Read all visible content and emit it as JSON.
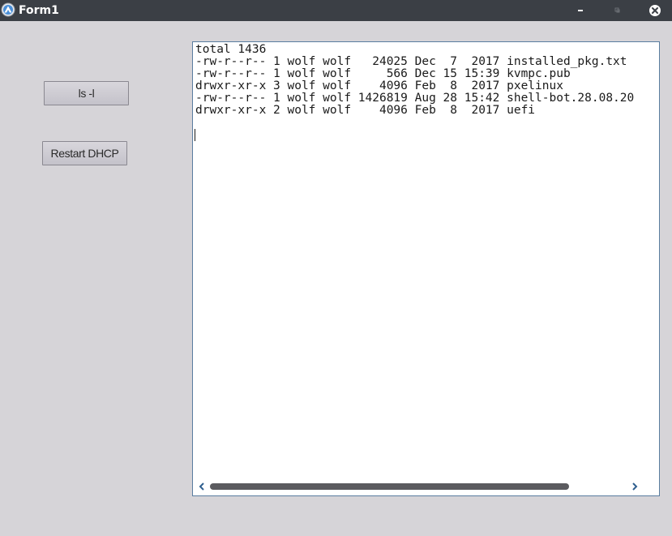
{
  "window": {
    "title": "Form1"
  },
  "titlebar": {
    "icons": {
      "app": "app-logo-icon",
      "minimize": "minimize-icon",
      "maximize": "maximize-icon",
      "close": "close-icon"
    }
  },
  "buttons": {
    "ls_label": "ls -l",
    "restart_dhcp_label": "Restart DHCP"
  },
  "terminal": {
    "lines": [
      "total 1436",
      "-rw-r--r-- 1 wolf wolf   24025 Dec  7  2017 installed_pkg.txt",
      "-rw-r--r-- 1 wolf wolf     566 Dec 15 15:39 kvmpc.pub",
      "drwxr-xr-x 3 wolf wolf    4096 Feb  8  2017 pxelinux",
      "-rw-r--r-- 1 wolf wolf 1426819 Aug 28 15:42 shell-bot.28.08.20",
      "drwxr-xr-x 2 wolf wolf    4096 Feb  8  2017 uefi"
    ],
    "scroll_icons": {
      "left": "chevron-left-icon",
      "right": "chevron-right-icon"
    }
  },
  "colors": {
    "titlebar": "#3b3f45",
    "window_bg": "#d6d4d8",
    "terminal_border": "#5a7da0",
    "scroll_thumb": "#5b5b5f"
  }
}
